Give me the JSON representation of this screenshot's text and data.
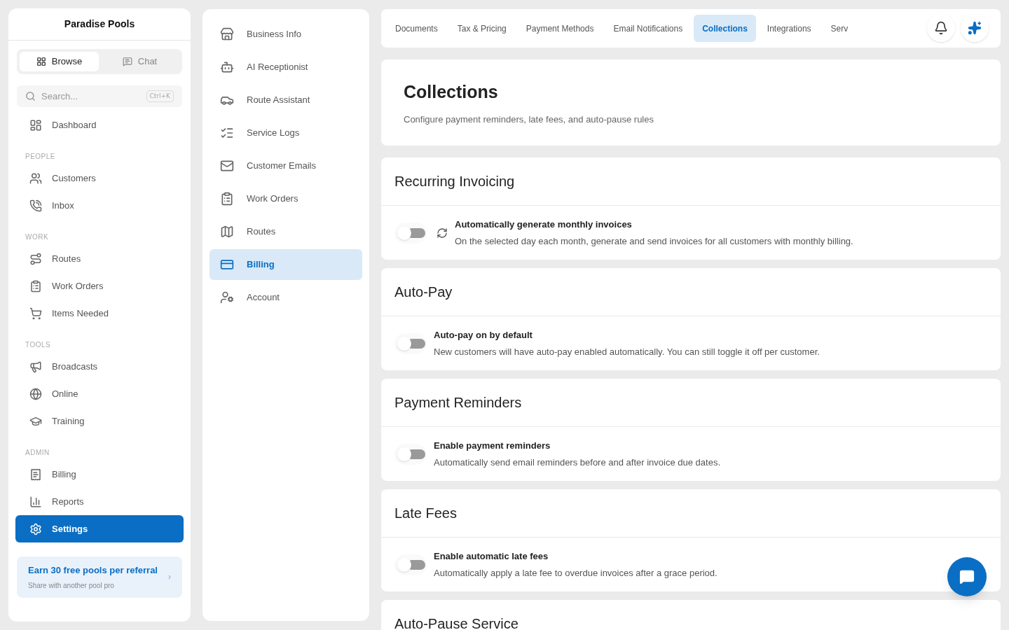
{
  "sidebar": {
    "brand": "Paradise Pools",
    "modes": [
      {
        "label": "Browse",
        "selected": true
      },
      {
        "label": "Chat",
        "selected": false
      }
    ],
    "search": {
      "placeholder": "Search...",
      "shortcut": "Ctrl+K"
    },
    "groups": [
      {
        "items": [
          {
            "label": "Dashboard",
            "selected": false
          }
        ]
      },
      {
        "heading": "PEOPLE",
        "items": [
          {
            "label": "Customers",
            "selected": false
          },
          {
            "label": "Inbox",
            "selected": false
          }
        ]
      },
      {
        "heading": "WORK",
        "items": [
          {
            "label": "Routes",
            "selected": false
          },
          {
            "label": "Work Orders",
            "selected": false
          },
          {
            "label": "Items Needed",
            "selected": false
          }
        ]
      },
      {
        "heading": "TOOLS",
        "items": [
          {
            "label": "Broadcasts",
            "selected": false
          },
          {
            "label": "Online",
            "selected": false
          },
          {
            "label": "Training",
            "selected": false
          }
        ]
      },
      {
        "heading": "ADMIN",
        "items": [
          {
            "label": "Billing",
            "selected": false
          },
          {
            "label": "Reports",
            "selected": false
          },
          {
            "label": "Settings",
            "selected": true
          }
        ]
      }
    ],
    "referral": {
      "title": "Earn 30 free pools per referral",
      "subtitle": "Share with another pool pro",
      "arrow": "›"
    }
  },
  "settings_nav": [
    {
      "label": "Business Info",
      "selected": false
    },
    {
      "label": "AI Receptionist",
      "selected": false
    },
    {
      "label": "Route Assistant",
      "selected": false
    },
    {
      "label": "Service Logs",
      "selected": false
    },
    {
      "label": "Customer Emails",
      "selected": false
    },
    {
      "label": "Work Orders",
      "selected": false
    },
    {
      "label": "Routes",
      "selected": false
    },
    {
      "label": "Billing",
      "selected": true
    },
    {
      "label": "Account",
      "selected": false
    }
  ],
  "tabs": [
    {
      "label": "Documents",
      "selected": false
    },
    {
      "label": "Tax & Pricing",
      "selected": false
    },
    {
      "label": "Payment Methods",
      "selected": false
    },
    {
      "label": "Email Notifications",
      "selected": false
    },
    {
      "label": "Collections",
      "selected": true
    },
    {
      "label": "Integrations",
      "selected": false
    },
    {
      "label": "Serv",
      "selected": false
    }
  ],
  "header": {
    "title": "Collections",
    "subtitle": "Configure payment reminders, late fees, and auto-pause rules"
  },
  "sections": [
    {
      "title": "Recurring Invoicing",
      "rows": [
        {
          "kind": "sync",
          "label": "Automatically generate monthly invoices",
          "description": "On the selected day each month, generate and send invoices for all customers with monthly billing.",
          "on": false
        }
      ]
    },
    {
      "title": "Auto-Pay",
      "rows": [
        {
          "kind": "plain",
          "label": "Auto-pay on by default",
          "description": "New customers will have auto-pay enabled automatically. You can still toggle it off per customer.",
          "on": false
        }
      ]
    },
    {
      "title": "Payment Reminders",
      "rows": [
        {
          "kind": "plain",
          "label": "Enable payment reminders",
          "description": "Automatically send email reminders before and after invoice due dates.",
          "on": false
        }
      ]
    },
    {
      "title": "Late Fees",
      "rows": [
        {
          "kind": "plain",
          "label": "Enable automatic late fees",
          "description": "Automatically apply a late fee to overdue invoices after a grace period.",
          "on": false
        }
      ]
    },
    {
      "title": "Auto-Pause Service"
    }
  ]
}
